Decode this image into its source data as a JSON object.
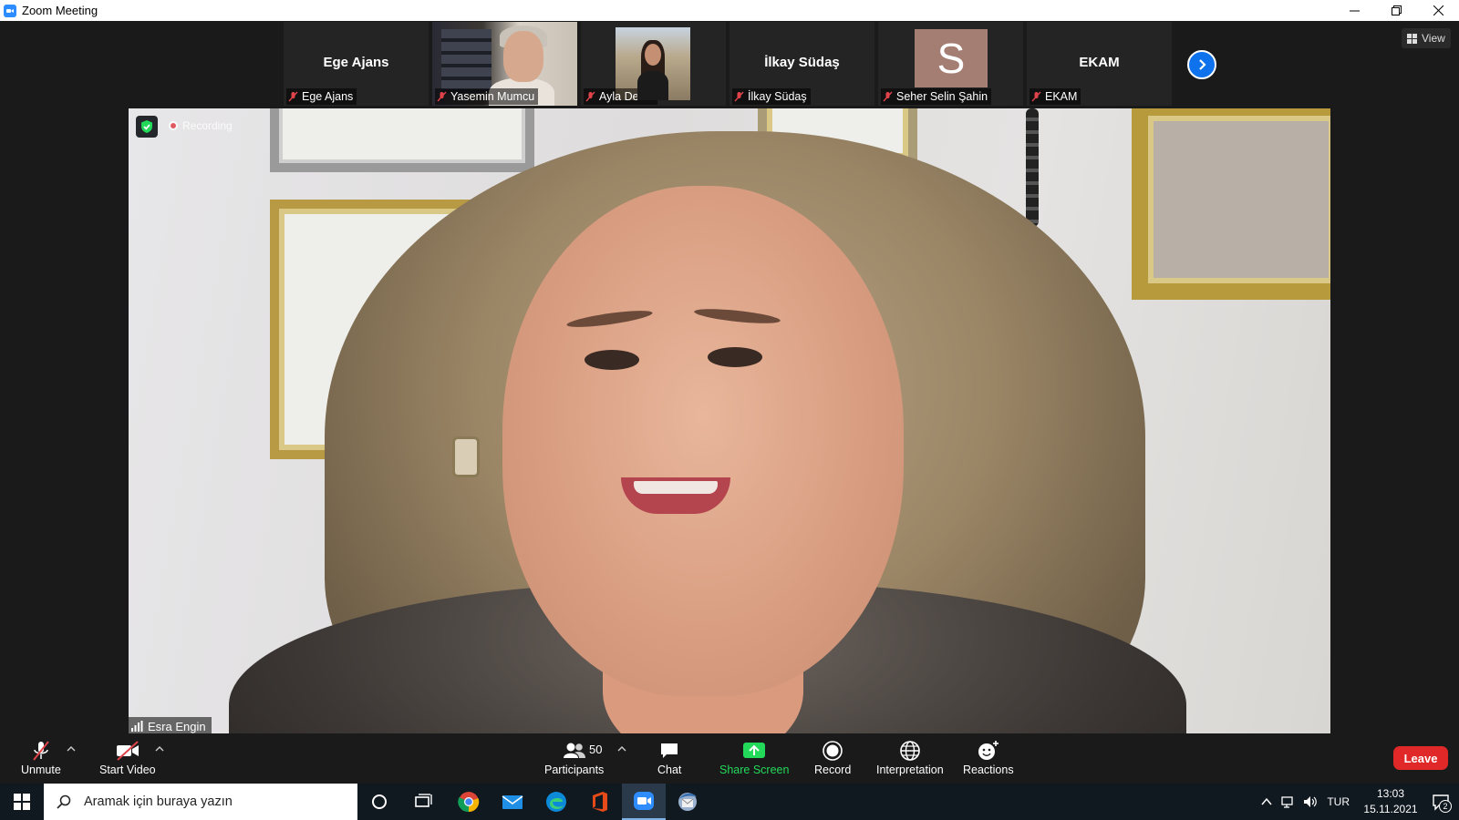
{
  "window": {
    "title": "Zoom Meeting",
    "controls": [
      "minimize-icon",
      "restore-icon",
      "close-icon"
    ]
  },
  "gallery": {
    "participants": [
      {
        "name": "Ege Ajans",
        "display": "Ege Ajans",
        "video": false,
        "muted": true
      },
      {
        "name": "Yasemin Mumcu",
        "video": true,
        "muted": true
      },
      {
        "name": "Ayla Deniz",
        "video": true,
        "muted": true
      },
      {
        "name": "İlkay Südaş",
        "display": "İlkay Südaş",
        "video": false,
        "muted": true
      },
      {
        "name": "Seher Selin Şahin",
        "avatar_letter": "S",
        "avatar_color": "#a47e73",
        "video": false,
        "muted": true
      },
      {
        "name": "EKAM",
        "display": "EKAM",
        "video": false,
        "muted": true
      }
    ],
    "next_page_icon": "chevron-right-icon",
    "view_label": "View"
  },
  "speaker": {
    "name": "Esra Engin",
    "recording_label": "Recording",
    "security_icon": "shield-check-icon"
  },
  "toolbar": {
    "unmute_label": "Unmute",
    "start_video_label": "Start Video",
    "participants_label": "Participants",
    "participants_count": "50",
    "chat_label": "Chat",
    "share_screen_label": "Share Screen",
    "record_label": "Record",
    "interpretation_label": "Interpretation",
    "reactions_label": "Reactions",
    "leave_label": "Leave"
  },
  "taskbar": {
    "search_placeholder": "Aramak için buraya yazın",
    "apps": [
      "cortana-icon",
      "task-view-icon",
      "chrome-icon",
      "mail-icon",
      "edge-icon",
      "office-icon",
      "zoom-icon",
      "mozilla-thunderbird-icon"
    ],
    "language": "TUR",
    "time": "13:03",
    "date": "15.11.2021",
    "notification_count": "2"
  },
  "colors": {
    "zoom_blue": "#0e72ed",
    "share_green": "#23d959",
    "leave_red": "#e02828",
    "muted_red": "#e0434a"
  }
}
